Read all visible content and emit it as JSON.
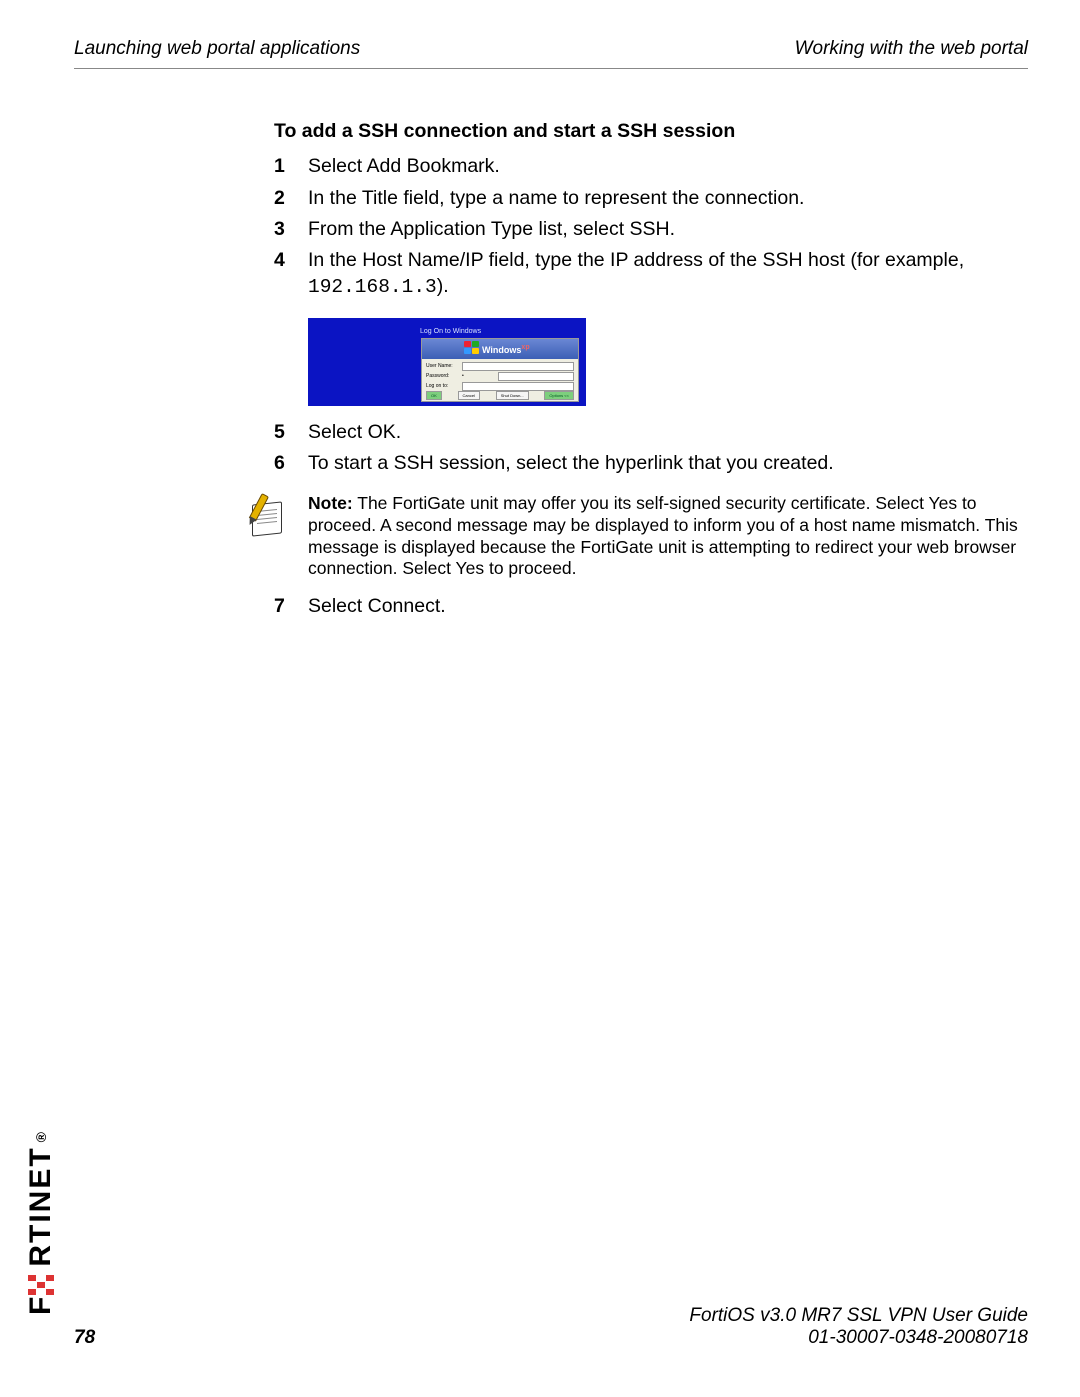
{
  "header": {
    "left": "Launching web portal applications",
    "right": "Working with the web portal"
  },
  "section_title": "To add a SSH connection and start a SSH session",
  "steps_a": [
    {
      "n": "1",
      "t": "Select Add Bookmark."
    },
    {
      "n": "2",
      "t": "In the Title field, type a name to represent the connection."
    },
    {
      "n": "3",
      "t": "From the Application Type list, select SSH."
    }
  ],
  "step4": {
    "n": "4",
    "prefix": "In the Host Name/IP field, type the IP address of the SSH host (for example, ",
    "code": "192.168.1.3",
    "suffix": ")."
  },
  "portal": {
    "title": "Log On to Windows",
    "win_text": "Windows",
    "win_sup": "xp",
    "labels": {
      "user": "User Name:",
      "pass": "Password:",
      "logon": "Log on to:"
    },
    "buttons": {
      "ok": "OK",
      "cancel": "Cancel",
      "shutdown": "Shut Down...",
      "options": "Options <<"
    }
  },
  "steps_b": [
    {
      "n": "5",
      "t": "Select OK."
    },
    {
      "n": "6",
      "t": "To start a SSH session, select the hyperlink that you created."
    }
  ],
  "note": {
    "label": "Note:",
    "body": " The FortiGate unit may offer you its self-signed security certificate. Select Yes to proceed. A second message may be displayed to inform you of a host name mismatch. This message is displayed because the FortiGate unit is attempting to redirect your web browser connection. Select Yes to proceed."
  },
  "steps_c": [
    {
      "n": "7",
      "t": "Select Connect."
    }
  ],
  "brand": {
    "pre": "F",
    "post": "RTINET",
    "mark": "®"
  },
  "footer": {
    "page": "78",
    "guide": "FortiOS v3.0 MR7 SSL VPN User Guide",
    "docnum": "01-30007-0348-20080718"
  }
}
